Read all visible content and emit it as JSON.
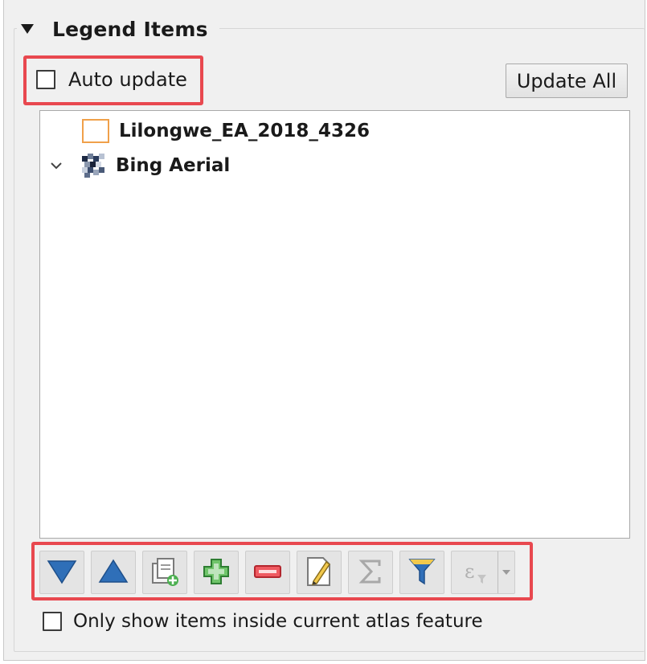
{
  "group": {
    "title": "Legend Items",
    "expanded": true
  },
  "auto_update": {
    "label": "Auto update",
    "checked": false
  },
  "update_all": {
    "label": "Update All"
  },
  "legend_tree": {
    "items": [
      {
        "label": "Lilongwe_EA_2018_4326",
        "icon": "polygon-swatch-icon",
        "swatch_color": "#f0a04a"
      },
      {
        "label": "Bing Aerial",
        "icon": "raster-layer-icon",
        "expander": "chevron-down-icon"
      }
    ]
  },
  "toolbar": {
    "buttons": [
      {
        "name": "move-down-button",
        "icon": "triangle-down-icon",
        "enabled": true
      },
      {
        "name": "move-up-button",
        "icon": "triangle-up-icon",
        "enabled": true
      },
      {
        "name": "add-group-button",
        "icon": "add-group-icon",
        "enabled": true
      },
      {
        "name": "add-item-button",
        "icon": "plus-icon",
        "enabled": true
      },
      {
        "name": "remove-item-button",
        "icon": "minus-icon",
        "enabled": true
      },
      {
        "name": "edit-item-button",
        "icon": "pencil-icon",
        "enabled": true
      },
      {
        "name": "count-features-button",
        "icon": "sigma-icon",
        "enabled": false
      },
      {
        "name": "filter-legend-button",
        "icon": "funnel-icon",
        "enabled": true
      },
      {
        "name": "filter-expression-button",
        "icon": "epsilon-icon",
        "enabled": false
      }
    ]
  },
  "only_show_atlas": {
    "label": "Only show items inside current atlas feature",
    "checked": false
  },
  "colors": {
    "highlight": "#e8484f",
    "arrow_blue": "#2f6fb8",
    "plus_green": "#4caf50",
    "minus_red": "#e0424a",
    "swatch_orange": "#f0a04a"
  }
}
